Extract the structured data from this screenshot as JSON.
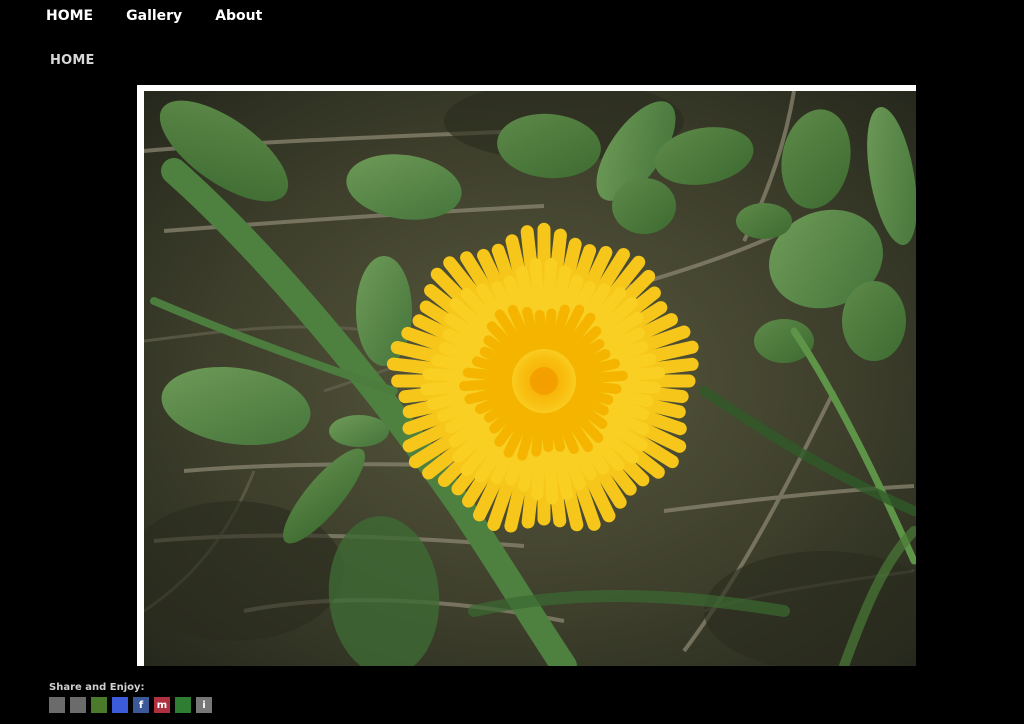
{
  "nav": {
    "items": [
      {
        "label": "HOME"
      },
      {
        "label": "Gallery"
      },
      {
        "label": "About"
      }
    ]
  },
  "breadcrumb": {
    "label": "HOME"
  },
  "photo": {
    "subject": "yellow-dandelion-flower"
  },
  "share": {
    "label": "Share and Enjoy:",
    "icons": [
      {
        "name": "print-icon",
        "glyph": "",
        "color": "#6b6b6b"
      },
      {
        "name": "digg-icon",
        "glyph": "",
        "color": "#6b6b6b"
      },
      {
        "name": "stumbleupon-icon",
        "glyph": "",
        "color": "#4a7a2a"
      },
      {
        "name": "delicious-icon",
        "glyph": "",
        "color": "#3b5bdb"
      },
      {
        "name": "facebook-icon",
        "glyph": "f",
        "color": "#3b5998"
      },
      {
        "name": "mixx-icon",
        "glyph": "m",
        "color": "#b03040"
      },
      {
        "name": "google-icon",
        "glyph": "",
        "color": "#2e7d32"
      },
      {
        "name": "info-icon",
        "glyph": "i",
        "color": "#777777"
      }
    ]
  },
  "colors": {
    "background": "#000000",
    "frame": "#ffffff",
    "flower": "#f7c400",
    "leaf": "#4a7a3a"
  }
}
